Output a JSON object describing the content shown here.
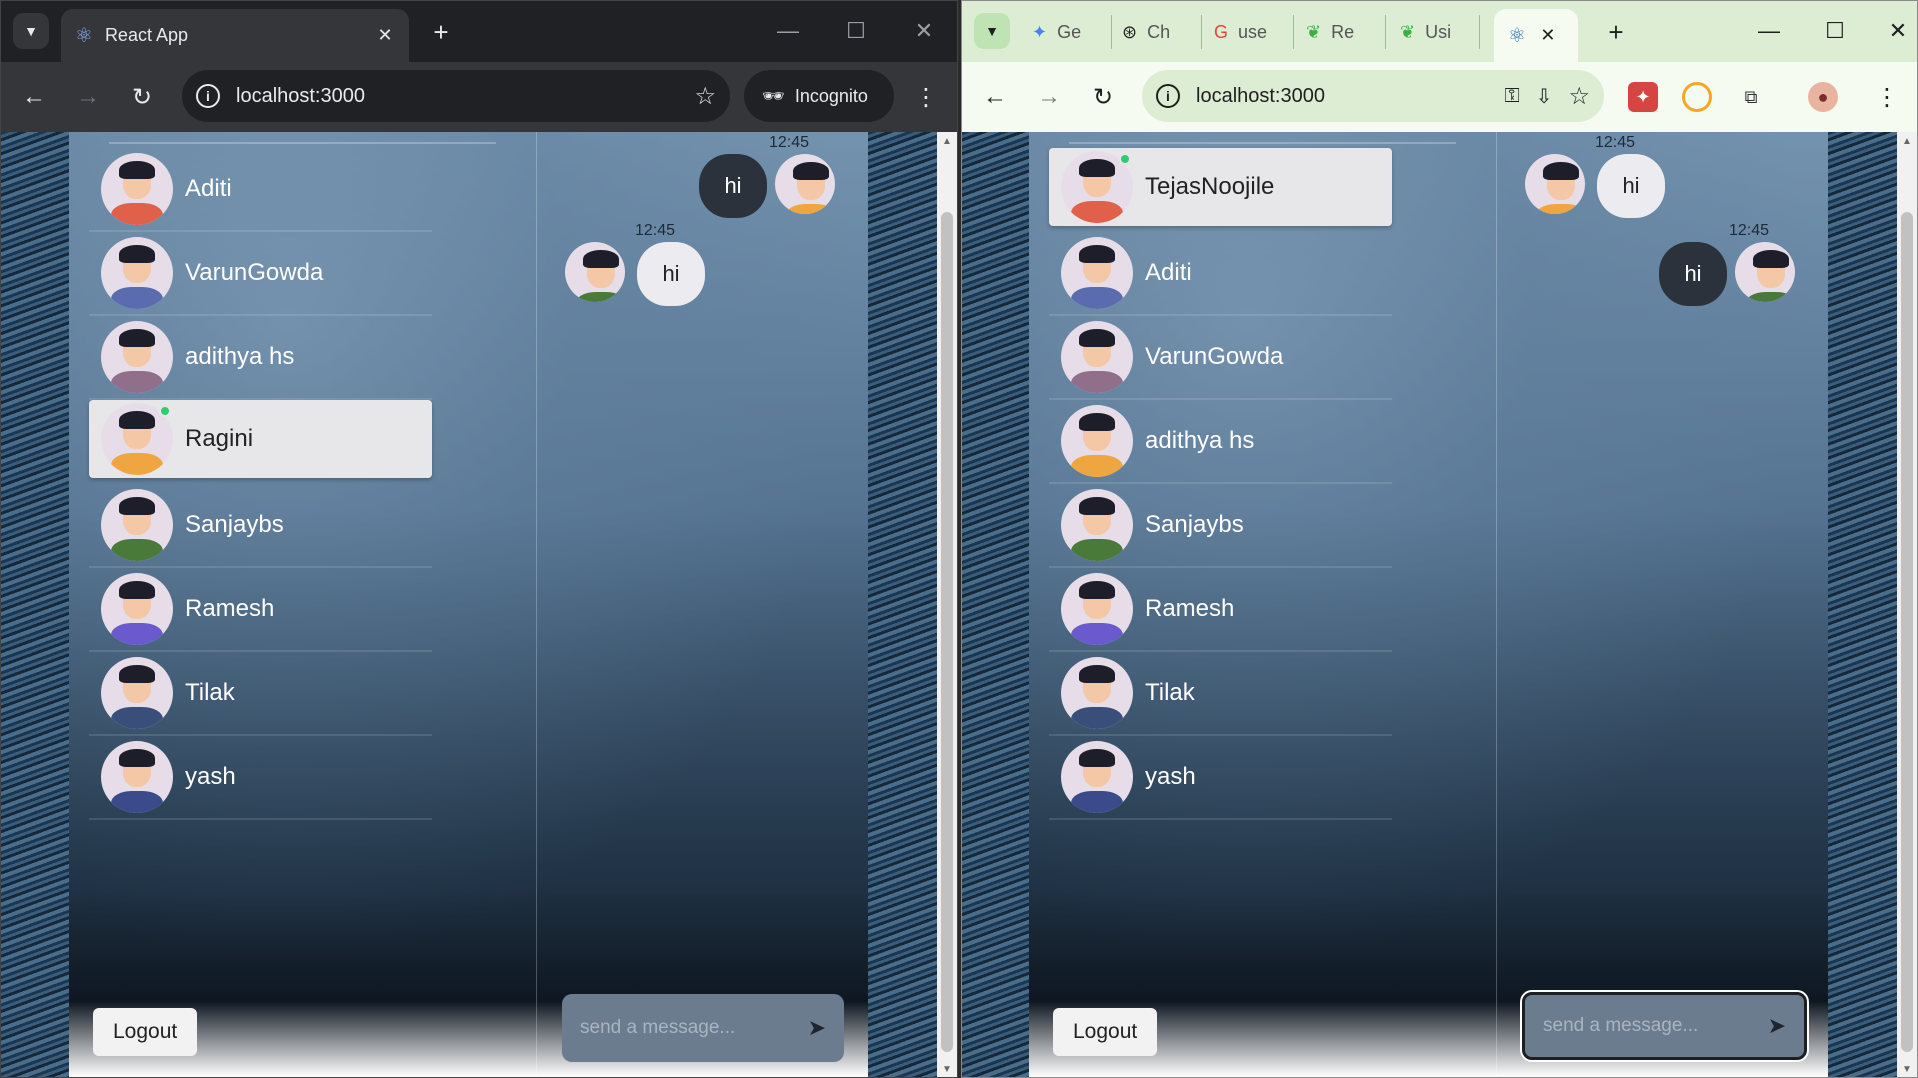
{
  "left_window": {
    "tab_title": "React App",
    "url": "localhost:3000",
    "incognito_label": "Incognito",
    "contacts": [
      {
        "name": "Aditi",
        "selected": false,
        "online": false
      },
      {
        "name": "VarunGowda",
        "selected": false,
        "online": false
      },
      {
        "name": "adithya hs",
        "selected": false,
        "online": false
      },
      {
        "name": "Ragini",
        "selected": true,
        "online": true
      },
      {
        "name": "Sanjaybs",
        "selected": false,
        "online": false
      },
      {
        "name": "Ramesh",
        "selected": false,
        "online": false
      },
      {
        "name": "Tilak",
        "selected": false,
        "online": false
      },
      {
        "name": "yash",
        "selected": false,
        "online": false
      }
    ],
    "logout_label": "Logout",
    "messages": [
      {
        "time": "12:45",
        "text": "hi",
        "side": "right"
      },
      {
        "time": "12:45",
        "text": "hi",
        "side": "left"
      }
    ],
    "compose_placeholder": "send a message..."
  },
  "right_window": {
    "tabs": [
      {
        "label": "Ge",
        "icon": "gemini-icon"
      },
      {
        "label": "Ch",
        "icon": "chatgpt-icon"
      },
      {
        "label": "use",
        "icon": "google-icon"
      },
      {
        "label": "Re",
        "icon": "leaf-icon"
      },
      {
        "label": "Usi",
        "icon": "leaf-icon"
      }
    ],
    "url": "localhost:3000",
    "contacts": [
      {
        "name": "TejasNoojile",
        "selected": true,
        "online": true
      },
      {
        "name": "Aditi",
        "selected": false,
        "online": false
      },
      {
        "name": "VarunGowda",
        "selected": false,
        "online": false
      },
      {
        "name": "adithya hs",
        "selected": false,
        "online": false
      },
      {
        "name": "Sanjaybs",
        "selected": false,
        "online": false
      },
      {
        "name": "Ramesh",
        "selected": false,
        "online": false
      },
      {
        "name": "Tilak",
        "selected": false,
        "online": false
      },
      {
        "name": "yash",
        "selected": false,
        "online": false
      }
    ],
    "logout_label": "Logout",
    "messages": [
      {
        "time": "12:45",
        "text": "hi",
        "side": "left"
      },
      {
        "time": "12:45",
        "text": "hi",
        "side": "right"
      }
    ],
    "compose_placeholder": "send a message..."
  },
  "colors": {
    "online_dot": "#2ecc71",
    "dark_bubble": "#2b323c",
    "light_bubble": "#ececf0",
    "selected_row": "#e7e7ea"
  }
}
